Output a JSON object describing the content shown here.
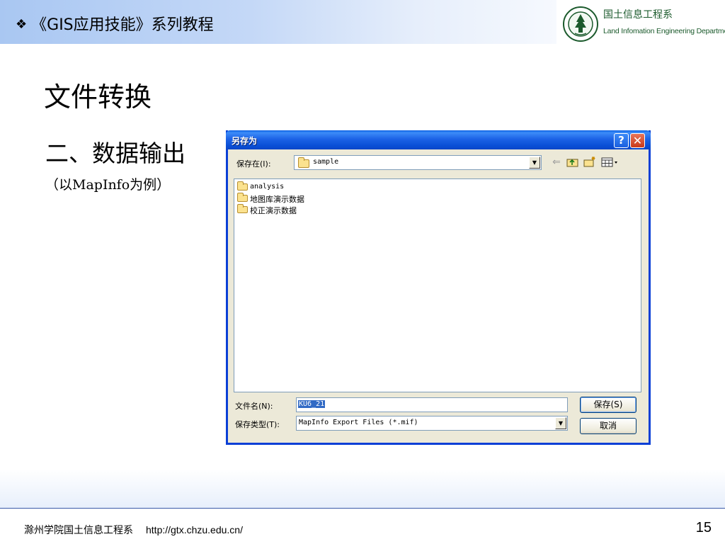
{
  "header": {
    "bullet": "❖",
    "title": "《GIS应用技能》系列教程",
    "logo_cn": "国土信息工程系",
    "logo_en": "Land Infomation Engineering Department"
  },
  "slide": {
    "title": "文件转换",
    "subtitle": "二、数据输出",
    "note": "（以MapInfo为例）"
  },
  "dialog": {
    "title": "另存为",
    "help_glyph": "?",
    "close_glyph": "✕",
    "save_in_label": "保存在(I):",
    "save_in_value": "sample",
    "files": [
      {
        "name": "analysis"
      },
      {
        "name": "地图库演示数据"
      },
      {
        "name": "校正演示数据"
      }
    ],
    "file_name_label": "文件名(N):",
    "file_name_value": "KU6_21",
    "file_type_label": "保存类型(T):",
    "file_type_value": "MapInfo Export Files (*.mif)",
    "save_button": "保存(S)",
    "cancel_button": "取消"
  },
  "footer": {
    "org": "滁州学院国土信息工程系",
    "url": "http://gtx.chzu.edu.cn/",
    "page": "15"
  },
  "colors": {
    "xp_titlebar": "#0a4fd6",
    "dialog_bg": "#ece9d8",
    "selection": "#316ac5",
    "logo_green": "#1b5a2c"
  }
}
